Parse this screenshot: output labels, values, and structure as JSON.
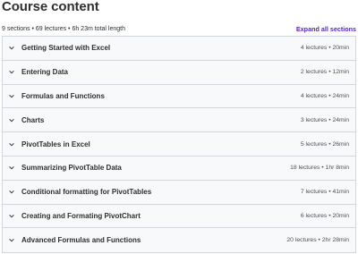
{
  "header": {
    "title": "Course content",
    "meta": "9 sections • 69 lectures • 6h 23m total length",
    "expand_label": "Expand all sections"
  },
  "sections": [
    {
      "title": "Getting Started with Excel",
      "info": "4 lectures • 20min"
    },
    {
      "title": "Entering Data",
      "info": "2 lectures • 12min"
    },
    {
      "title": "Formulas and Functions",
      "info": "4 lectures • 24min"
    },
    {
      "title": "Charts",
      "info": "3 lectures • 24min"
    },
    {
      "title": "PivotTables in Excel",
      "info": "5 lectures • 26min"
    },
    {
      "title": "Summarizing PivotTable Data",
      "info": "18 lectures • 1hr 8min"
    },
    {
      "title": "Conditional formatting for PivotTables",
      "info": "7 lectures • 41min"
    },
    {
      "title": "Creating and Formating PivotChart",
      "info": "6 lectures • 20min"
    },
    {
      "title": "Advanced Formulas and Functions",
      "info": "20 lectures • 2hr 28min"
    }
  ],
  "icons": {
    "expand_toggle": "chevron-down-icon"
  },
  "colors": {
    "accent": "#5624d0",
    "row_background": "#f7f9fa",
    "border": "#d1d7dc",
    "text": "#2d2f31"
  }
}
